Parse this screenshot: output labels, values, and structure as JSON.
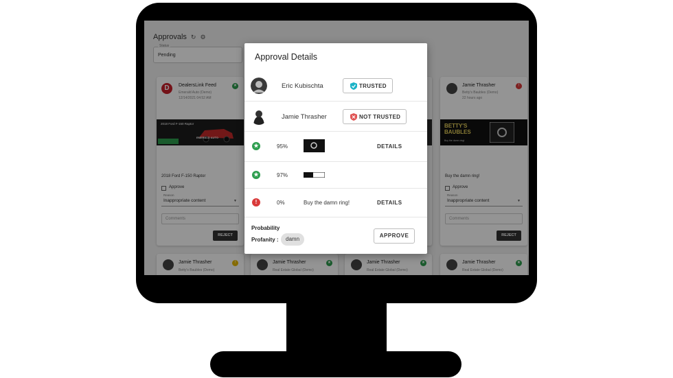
{
  "colors": {
    "trusted_shield": "#1bb3c7",
    "not_trusted_shield": "#e05555",
    "success": "#2e9e4f",
    "error": "#d93a3a"
  },
  "app": {
    "title": "Approvals",
    "refresh_icon": "refresh-icon",
    "settings_icon": "gear-icon",
    "status": {
      "label": "Status",
      "value": "Pending"
    }
  },
  "cards": {
    "left": {
      "name": "DealersLink Feed",
      "sub1": "Emerald Auto (Demo)",
      "sub2": "12/14/2021 04:52 AM",
      "banner_text1": "2018 Ford F-150 Raptor",
      "banner_text2": "EMERALD AUTO",
      "caption": "2018 Ford F-150 Raptor",
      "approve_label": "Approve",
      "reason_label": "Reason",
      "reason_value": "Inappropriate content",
      "comments_placeholder": "Comments",
      "reject_label": "REJECT"
    },
    "right": {
      "name": "Jamie Thrasher",
      "sub1": "Betty's Baubles (Demo)",
      "sub2": "22 hours ago",
      "banner_text": "BETTY'S BAUBLES",
      "banner_sub": "Buy the damn ring!",
      "caption": "Buy the damn ring!",
      "approve_label": "Approve",
      "reason_label": "Reason",
      "reason_value": "Inappropriate content",
      "comments_placeholder": "Comments",
      "reject_label": "REJECT"
    },
    "bottom": [
      {
        "name": "Jamie Thrasher",
        "sub": "Betty's Baubles (Demo)"
      },
      {
        "name": "Jamie Thrasher",
        "sub": "Real Estate Global (Demo)"
      },
      {
        "name": "Jamie Thrasher",
        "sub": "Real Estate Global (Demo)"
      },
      {
        "name": "Jamie Thrasher",
        "sub": "Real Estate Global (Demo)"
      }
    ]
  },
  "modal": {
    "title": "Approval Details",
    "users": [
      {
        "name": "Eric Kubischta",
        "badge": "TRUSTED"
      },
      {
        "name": "Jamie Thrasher",
        "badge": "NOT TRUSTED"
      }
    ],
    "checks": [
      {
        "status": "pass",
        "percent": "95%",
        "action": "DETAILS"
      },
      {
        "status": "pass",
        "percent": "97%"
      },
      {
        "status": "fail",
        "percent": "0%",
        "text": "Buy the damn ring!",
        "action": "DETAILS"
      }
    ],
    "probability_label": "Probability",
    "profanity_label": "Profanity :",
    "profanity_word": "damn",
    "approve_label": "APPROVE"
  }
}
